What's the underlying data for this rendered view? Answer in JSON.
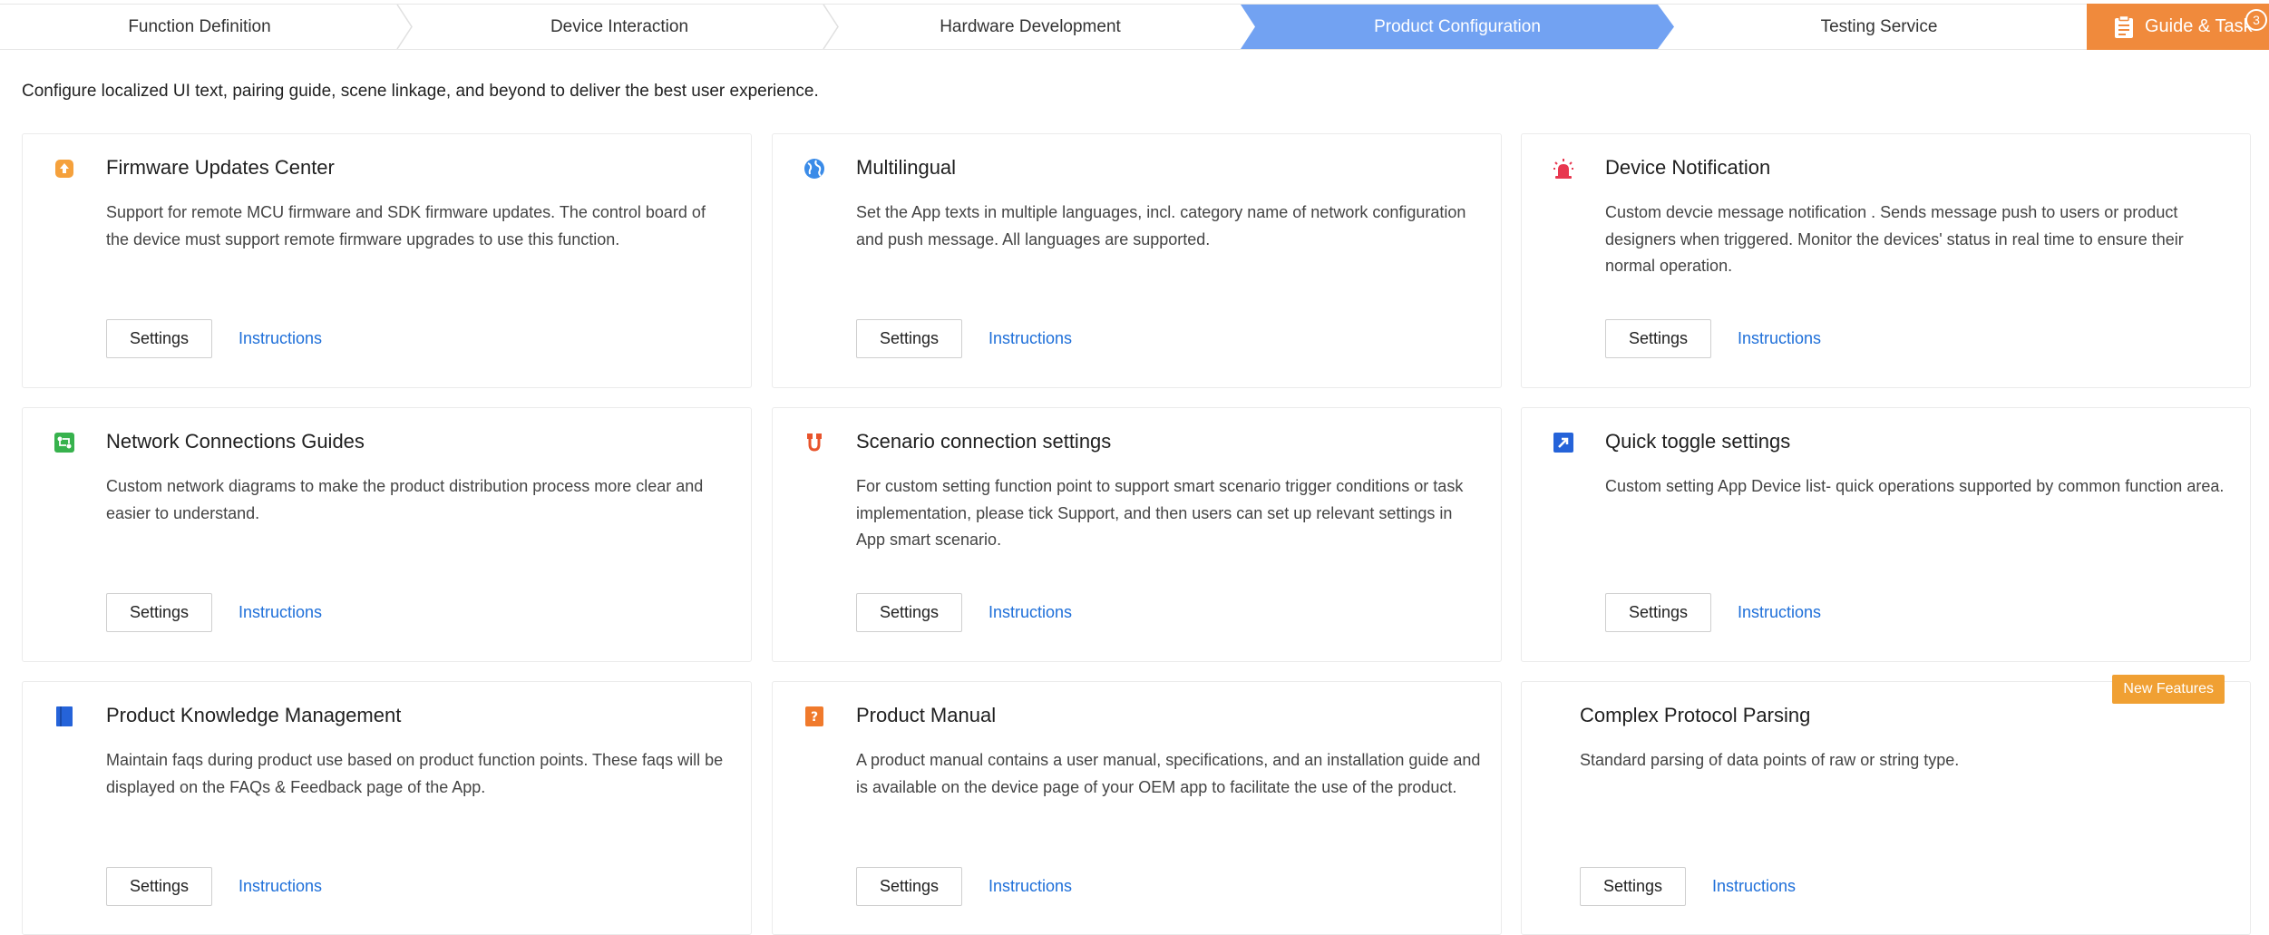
{
  "steps": [
    {
      "label": "Function Definition"
    },
    {
      "label": "Device Interaction"
    },
    {
      "label": "Hardware Development"
    },
    {
      "label": "Product Configuration",
      "active": true
    },
    {
      "label": "Testing Service"
    }
  ],
  "guide": {
    "label": "Guide & Task",
    "count": "3"
  },
  "intro": "Configure localized UI text, pairing guide, scene linkage, and beyond to deliver the best user experience.",
  "colors": {
    "active_step": "#72a2f2",
    "accent": "#f08a3c",
    "link": "#1e6fd9",
    "new_tag": "#f0a033"
  },
  "cards": [
    {
      "title": "Firmware Updates Center",
      "icon": "firmware-upload-icon",
      "desc": "Support for remote MCU firmware and SDK firmware updates. The control board of the device must support remote firmware upgrades to use this function.",
      "settings": "Settings",
      "instructions": "Instructions"
    },
    {
      "title": "Multilingual",
      "icon": "globe-icon",
      "desc": "Set the App texts in multiple languages, incl. category name of network configuration and push message. All languages are supported.",
      "settings": "Settings",
      "instructions": "Instructions"
    },
    {
      "title": "Device Notification",
      "icon": "alarm-icon",
      "desc": "Custom devcie message notification . Sends message push to users or product designers when triggered. Monitor the devices' status in real time to ensure their normal operation.",
      "settings": "Settings",
      "instructions": "Instructions"
    },
    {
      "title": "Network Connections Guides",
      "icon": "network-guide-icon",
      "desc": "Custom network diagrams to make the product distribution process more clear and easier to understand.",
      "settings": "Settings",
      "instructions": "Instructions"
    },
    {
      "title": "Scenario connection settings",
      "icon": "scenario-link-icon",
      "desc": "For custom setting function point to support smart scenario trigger conditions or task implementation, please tick Support, and then users can set up relevant settings in App smart scenario.",
      "settings": "Settings",
      "instructions": "Instructions"
    },
    {
      "title": "Quick toggle settings",
      "icon": "quick-toggle-icon",
      "desc": "Custom setting App Device list- quick operations supported by common function area.",
      "settings": "Settings",
      "instructions": "Instructions"
    },
    {
      "title": "Product Knowledge Management",
      "icon": "book-icon",
      "desc": "Maintain faqs during product use based on product function points. These faqs will be displayed on the FAQs & Feedback page of the App.",
      "settings": "Settings",
      "instructions": "Instructions"
    },
    {
      "title": "Product Manual",
      "icon": "manual-question-icon",
      "desc": "A product manual contains a user manual, specifications, and an installation guide and is available on the device page of your OEM app to facilitate the use of the product.",
      "settings": "Settings",
      "instructions": "Instructions"
    },
    {
      "title": "Complex Protocol Parsing",
      "icon": "",
      "desc": "Standard parsing of data points of raw or string type.",
      "settings": "Settings",
      "instructions": "Instructions",
      "tag": "New Features"
    }
  ]
}
